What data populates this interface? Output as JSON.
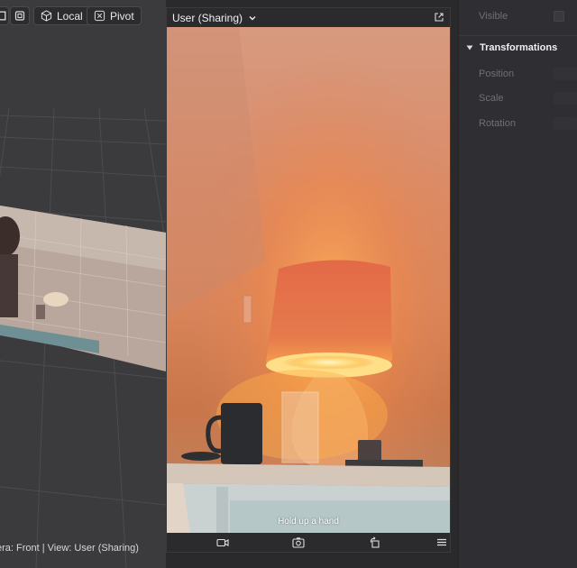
{
  "viewport": {
    "toolbar": {
      "local_label": "Local",
      "pivot_label": "Pivot"
    },
    "status_text": "era: Front | View: User (Sharing)"
  },
  "preview": {
    "title": "User (Sharing)",
    "hint": "Hold up a hand"
  },
  "inspector": {
    "visible_label": "Visible",
    "section_title": "Transformations",
    "fields": [
      "Position",
      "Scale",
      "Rotation"
    ]
  },
  "colors": {
    "panel_bg": "#2a2a2d",
    "viewport_bg": "#3b3b3e",
    "accent_orange": "#e8915e",
    "lamp_glow": "#ffd36b"
  }
}
